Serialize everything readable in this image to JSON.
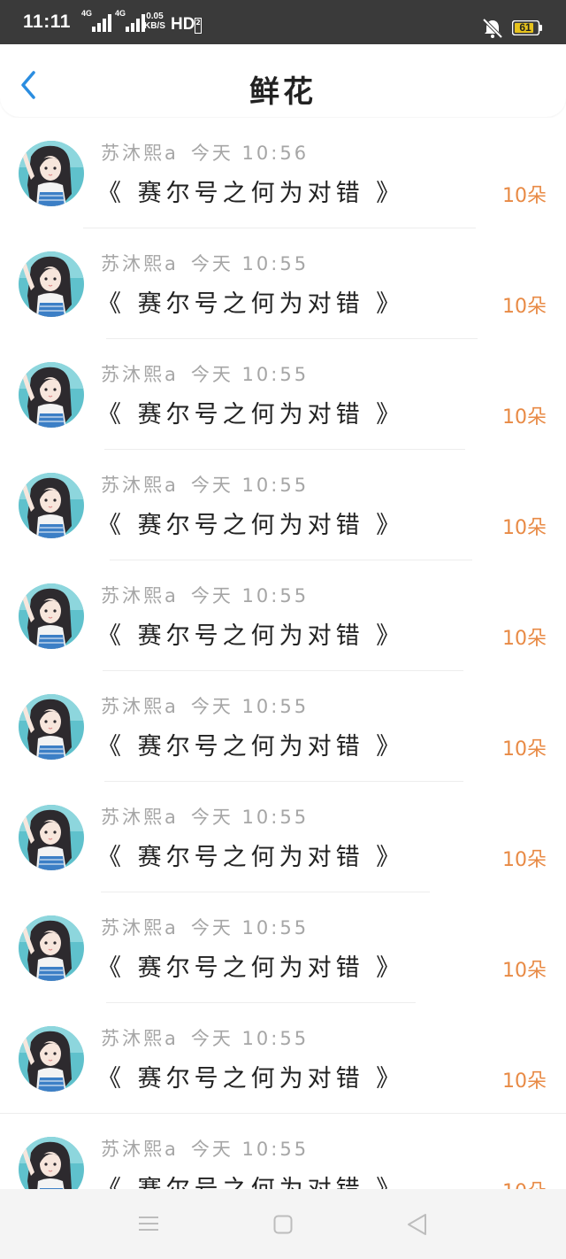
{
  "status_bar": {
    "time": "11:11",
    "signal1_label": "4G",
    "signal2_label": "4G",
    "net_speed_value": "0.05",
    "net_speed_unit": "KB/S",
    "hd_label": "HD",
    "hd_sub": "2",
    "battery_level": "61",
    "mute_icon": "bell-off-icon",
    "battery_color": "#e6c21c"
  },
  "header": {
    "back_icon": "chevron-left-icon",
    "title": "鲜花",
    "accent_color": "#2b8de0"
  },
  "list": {
    "items": [
      {
        "user": "苏沐熙a",
        "time": "今天 10:56",
        "title": "《 赛尔号之何为对错 》",
        "count": "10朵"
      },
      {
        "user": "苏沐熙a",
        "time": "今天 10:55",
        "title": "《 赛尔号之何为对错 》",
        "count": "10朵"
      },
      {
        "user": "苏沐熙a",
        "time": "今天 10:55",
        "title": "《 赛尔号之何为对错 》",
        "count": "10朵"
      },
      {
        "user": "苏沐熙a",
        "time": "今天 10:55",
        "title": "《 赛尔号之何为对错 》",
        "count": "10朵"
      },
      {
        "user": "苏沐熙a",
        "time": "今天 10:55",
        "title": "《 赛尔号之何为对错 》",
        "count": "10朵"
      },
      {
        "user": "苏沐熙a",
        "time": "今天 10:55",
        "title": "《 赛尔号之何为对错 》",
        "count": "10朵"
      },
      {
        "user": "苏沐熙a",
        "time": "今天 10:55",
        "title": "《 赛尔号之何为对错 》",
        "count": "10朵"
      },
      {
        "user": "苏沐熙a",
        "time": "今天 10:55",
        "title": "《 赛尔号之何为对错 》",
        "count": "10朵"
      },
      {
        "user": "苏沐熙a",
        "time": "今天 10:55",
        "title": "《 赛尔号之何为对错 》",
        "count": "10朵"
      },
      {
        "user": "苏沐熙a",
        "time": "今天 10:55",
        "title": "《 赛尔号之何为对错 》",
        "count": "10朵"
      }
    ],
    "count_color": "#e88a45"
  },
  "nav_bar": {
    "menu_icon": "menu-icon",
    "home_icon": "square-home-icon",
    "back_icon": "triangle-back-icon"
  }
}
